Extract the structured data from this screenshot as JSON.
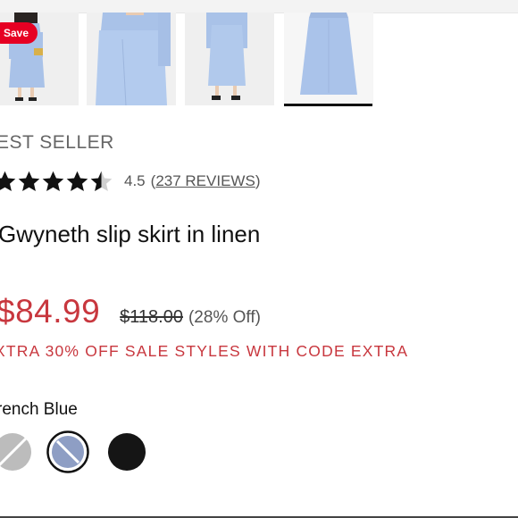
{
  "save_button": {
    "label": "Save"
  },
  "thumbnails": [
    {
      "name": "model-front-view"
    },
    {
      "name": "model-waist-detail"
    },
    {
      "name": "model-back-view"
    },
    {
      "name": "skirt-flat-view",
      "selected": true
    }
  ],
  "product": {
    "badge": "EST SELLER",
    "rating_value": "4.5",
    "rating_stars": 4.5,
    "reviews_open": "(",
    "reviews_link": "237 REVIEWS",
    "reviews_close": ")",
    "title": "Gwyneth slip skirt in linen",
    "sale_price": "$84.99",
    "original_price": "$118.00",
    "percent_off": "(28% Off)",
    "promo": "XTRA 30% OFF SALE STYLES WITH CODE EXTRA",
    "color_label": "rench Blue"
  },
  "swatches": [
    {
      "name": "light-grey",
      "color": "#b8b8b8",
      "selected": false
    },
    {
      "name": "french-blue",
      "color": "#8e9ec4",
      "selected": true
    },
    {
      "name": "black",
      "color": "#151515",
      "selected": false
    }
  ],
  "colors": {
    "sale_red": "#c8373e",
    "save_red": "#e60023",
    "skirt_blue": "#a9c2e8"
  }
}
